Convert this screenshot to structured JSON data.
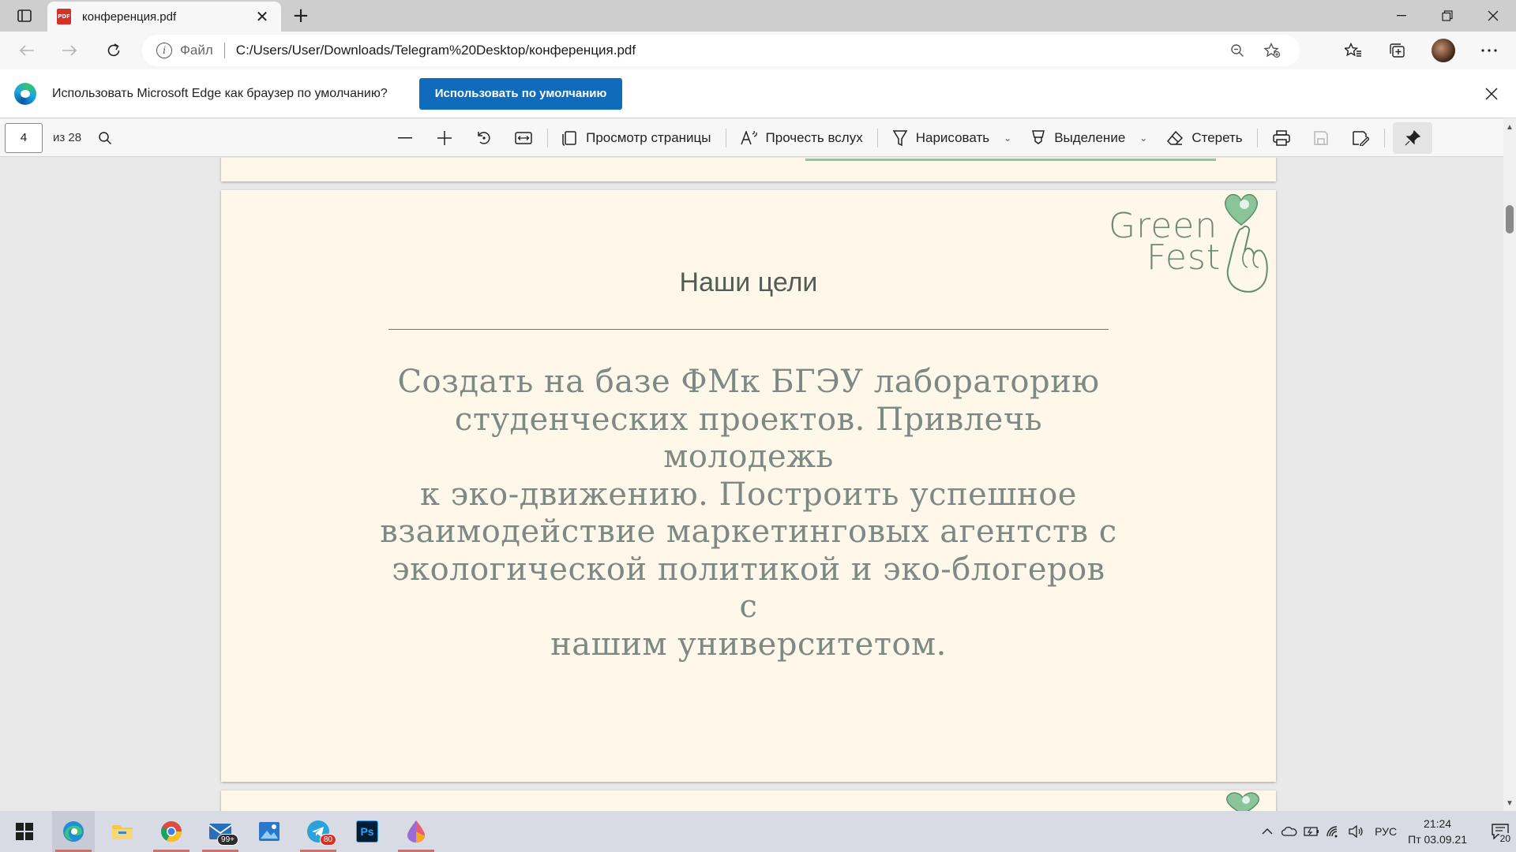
{
  "browser": {
    "tab": {
      "title": "конференция.pdf",
      "icon": "pdf-file-icon",
      "close_glyph": "✕"
    },
    "new_tab_glyph": "+",
    "address": {
      "scheme_label": "Файл",
      "url": "C:/Users/User/Downloads/Telegram%20Desktop/конференция.pdf"
    }
  },
  "infobar": {
    "message": "Использовать Microsoft Edge как браузер по умолчанию?",
    "button_label": "Использовать по умолчанию"
  },
  "pdf_toolbar": {
    "page_number": "4",
    "page_total": "из 28",
    "page_view_label": "Просмотр страницы",
    "read_aloud_label": "Прочесть вслух",
    "draw_label": "Нарисовать",
    "highlight_label": "Выделение",
    "erase_label": "Стереть"
  },
  "document": {
    "logo_line1": "Green",
    "logo_line2": "Fest",
    "page_title": "Наши цели",
    "body_lines": [
      "Создать на базе ФМк БГЭУ лабораторию",
      "студенческих проектов. Привлечь молодежь",
      "к эко-движению. Построить успешное",
      "взаимодействие маркетинговых агентств с",
      "экологической политикой и эко-блогеров с",
      "нашим университетом."
    ],
    "colors": {
      "page_bg": "#fff8ea",
      "text": "#7b8a82",
      "logo": "#6c8a78",
      "accent_green": "#86c8a1"
    }
  },
  "taskbar": {
    "mail_badge": "99+",
    "telegram_badge": "80",
    "photoshop_label": "Ps",
    "language": "РУС",
    "time": "21:24",
    "date": "Пт 03.09.21",
    "notifications_count": "20"
  }
}
